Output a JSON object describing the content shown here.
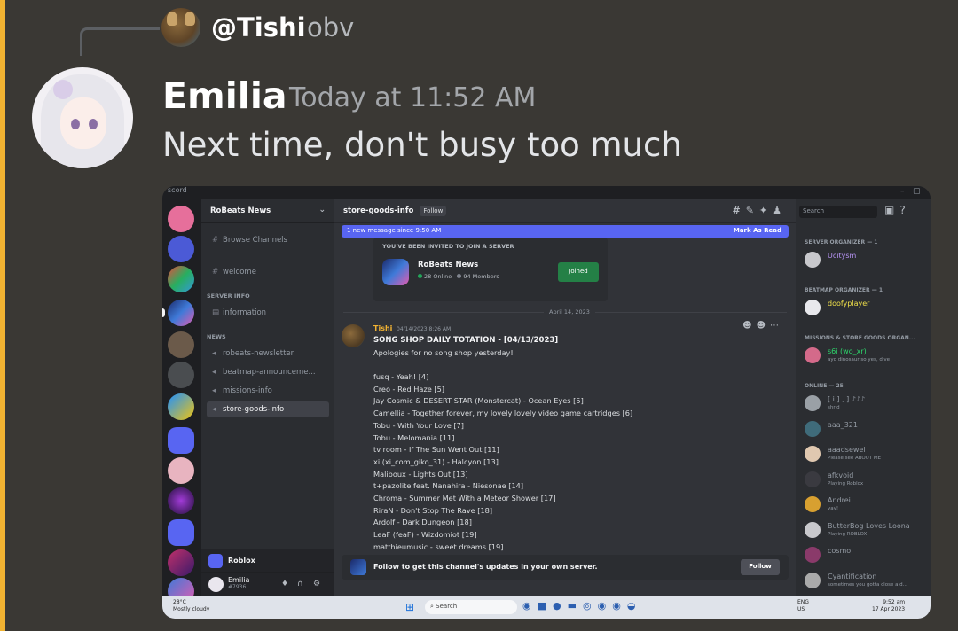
{
  "reply": {
    "name": "@Tishi",
    "text": "obv"
  },
  "message": {
    "author": "Emilia",
    "timestamp": "Today at 11:52 AM",
    "content": "Next time, don't busy too much"
  },
  "screenshot": {
    "window_title": "scord",
    "server_name": "RoBeats News",
    "channels": {
      "browse": "Browse Channels",
      "welcome": "welcome",
      "cat_server_info": "SERVER INFO",
      "information": "information",
      "cat_news": "NEWS",
      "items": [
        "robeats-newsletter",
        "beatmap-announceme...",
        "missions-info",
        "store-goods-info"
      ]
    },
    "voice": {
      "label": "Roblox"
    },
    "user": {
      "name": "Emilia",
      "status": "#7936"
    },
    "header": {
      "channel": "store-goods-info",
      "follow": "Follow"
    },
    "new_banner": {
      "text": "1 new message since 9:50 AM",
      "action": "Mark As Read"
    },
    "invite": {
      "title": "YOU'VE BEEN INVITED TO JOIN A SERVER",
      "name": "RoBeats News",
      "online": "28 Online",
      "members": "94 Members",
      "button": "Joined"
    },
    "date_divider": "April 14, 2023",
    "post": {
      "author": "Tishi",
      "date": "04/14/2023 8:26 AM",
      "title": "SONG SHOP DAILY TOTATION - [04/13/2023]",
      "intro": "Apologies for no song shop yesterday!",
      "lines": [
        "fusq - Yeah! [4]",
        "Creo - Red Haze [5]",
        "Jay Cosmic & DESERT STAR (Monstercat) - Ocean Eyes [5]",
        "Camellia - Together forever, my lovely lovely video game cartridges [6]",
        "Tobu - With Your Love [7]",
        "Tobu - Melomania [11]",
        "tv room - If The Sun Went Out [11]",
        "xi (xi_com_giko_31) - Halcyon [13]",
        "Maliboux - Lights Out [13]",
        "t+pazolite feat. Nanahira - Niesonae [14]",
        "Chroma - Summer Met With a Meteor Shower [17]",
        "RiraN - Don't Stop The Rave [18]",
        "Ardolf - Dark Dungeon [18]",
        "LeaF (feaF) - Wizdomiot [19]",
        "matthieumusic - sweet dreams [19]"
      ]
    },
    "follow_bar": {
      "text": "Follow to get this channel's updates in your own server.",
      "button": "Follow"
    },
    "search_placeholder": "Search",
    "members": {
      "cat1": "SERVER ORGANIZER — 1",
      "m1": "Ucitysm",
      "cat2": "BEATMAP ORGANIZER — 1",
      "m2": "doofyplayer",
      "cat3": "MISSIONS & STORE GOODS ORGAN...",
      "m3": "s6i (wo_xr)",
      "m3sub": "ayo dinosaur so yes, dive",
      "cat4": "ONLINE — 25",
      "online": [
        {
          "name": "[ i ] , ] ♪♪♪",
          "sub": "shrld"
        },
        {
          "name": "aaa_321",
          "sub": ""
        },
        {
          "name": "aaadsewel",
          "sub": "Please see ABOUT ME"
        },
        {
          "name": "afkvoid",
          "sub": "Playing Roblox"
        },
        {
          "name": "Andrei",
          "sub": "yay!"
        },
        {
          "name": "ButterBog Loves Loona",
          "sub": "Playing ROBLOX"
        },
        {
          "name": "cosmo",
          "sub": ""
        },
        {
          "name": "Cyantification",
          "sub": "sometimes you gotta close a d..."
        }
      ]
    },
    "taskbar": {
      "temp": "28°C",
      "weather": "Mostly cloudy",
      "search": "Search",
      "lang1": "ENG",
      "lang2": "US",
      "time": "9:52 am",
      "date": "17 Apr 2023"
    }
  }
}
